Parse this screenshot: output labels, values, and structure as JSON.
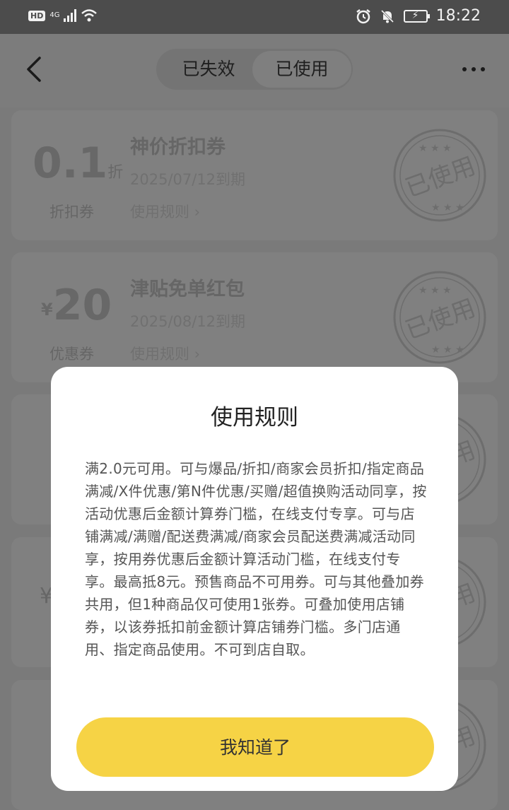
{
  "status_bar": {
    "hd": "HD",
    "network": "4G",
    "time": "18:22"
  },
  "header": {
    "tabs": [
      {
        "label": "已失效",
        "active": false
      },
      {
        "label": "已使用",
        "active": true
      }
    ],
    "back_icon": "chevron-left-icon",
    "more_icon": "more-dots-icon"
  },
  "coupons": [
    {
      "amount": "0.1",
      "unit": "折",
      "kind": "折扣券",
      "title": "神价折扣券",
      "expiry": "2025/07/12到期",
      "rule_link": "使用规则 ›",
      "stamp": "已使用"
    },
    {
      "currency": "¥",
      "amount": "20",
      "kind": "优惠券",
      "title": "津贴免单红包",
      "expiry": "2025/08/12到期",
      "rule_link": "使用规则 ›",
      "stamp": "已使用"
    },
    {
      "stamp": "已使用"
    },
    {
      "currency": "¥",
      "stamp": "已使用"
    },
    {
      "stamp": "已使用"
    }
  ],
  "modal": {
    "title": "使用规则",
    "body": "满2.0元可用。可与爆品/折扣/商家会员折扣/指定商品满减/X件优惠/第N件优惠/买赠/超值换购活动同享，按活动优惠后金额计算券门槛，在线支付专享。可与店铺满减/满赠/配送费满减/商家会员配送费满减活动同享，按用券优惠后金额计算活动门槛，在线支付专享。最高抵8元。预售商品不可用券。可与其他叠加券共用，但1种商品仅可使用1张券。可叠加使用店铺券，以该券抵扣前金额计算店铺券门槛。多门店通用、指定商品使用。不可到店自取。",
    "ok_label": "我知道了"
  },
  "colors": {
    "accent": "#f6d345",
    "overlay": "#7a7a7a"
  }
}
